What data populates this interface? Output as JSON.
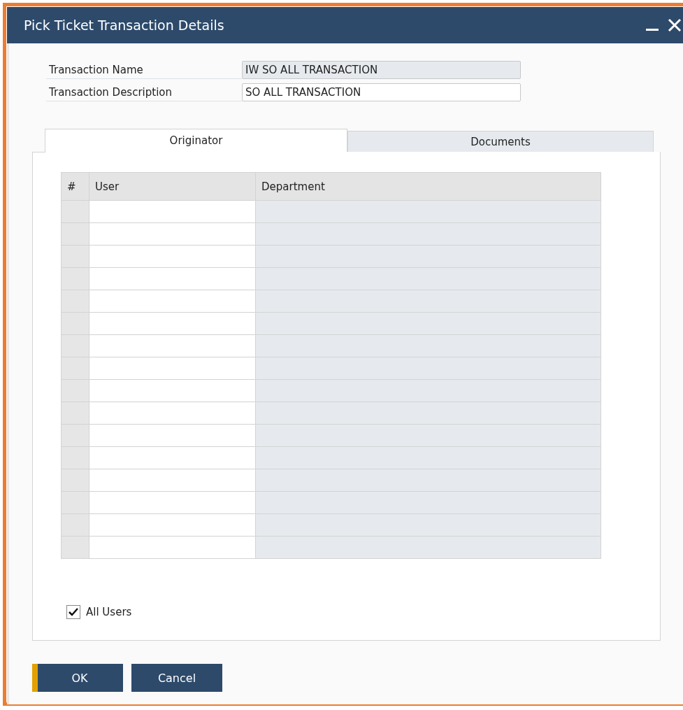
{
  "window": {
    "title": "Pick Ticket Transaction Details",
    "controls": [
      {
        "kind": "minimize"
      },
      {
        "kind": "close"
      }
    ]
  },
  "fields": [
    {
      "label": "Transaction Name",
      "value": "IW SO ALL TRANSACTION",
      "disabled": true
    },
    {
      "label": "Transaction Description",
      "value": "SO ALL TRANSACTION",
      "disabled": false
    }
  ],
  "tabs": [
    {
      "label": "Originator",
      "selected": true
    },
    {
      "label": "Documents",
      "selected": false
    }
  ],
  "table": {
    "columns": [
      "#",
      "User",
      "Department"
    ]
  },
  "all_users": {
    "label": "All Users",
    "checked": true
  },
  "buttons": [
    {
      "label": "OK",
      "default": true
    },
    {
      "label": "Cancel",
      "default": false
    }
  ]
}
